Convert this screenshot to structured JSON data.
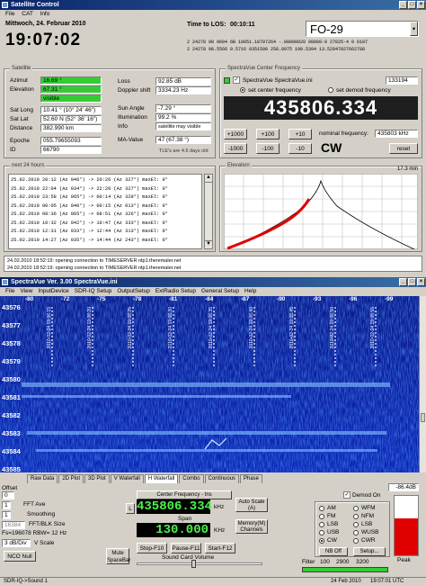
{
  "app1": {
    "title": "Satellite Control",
    "menu": [
      "File",
      "CAT",
      "Info"
    ]
  },
  "clock": {
    "date": "Mittwoch, 24. Februar 2010",
    "time": "19:07:02",
    "los_label": "Time to LOS:",
    "los_value": "00:10:11"
  },
  "sat": {
    "name": "FO-29",
    "tle1": "2 24278 98  9604 6B   10051.18707264  -.00000020  00000-0  27025-4  0  6107",
    "tle2": "2 24278  98.5566  9.5716  0351500  258.8975  190.5394  13.52947827662788"
  },
  "satellite": {
    "label": "Satellite",
    "azimut_label": "Azimut",
    "azimut": "16.69 °",
    "elevation_label": "Elevation",
    "elevation": "67.31 °",
    "status": "visible",
    "satlong_label": "Sat Long",
    "satlong": "10.41 ° (10° 24' 46\")",
    "satlat_label": "Sat Lat",
    "satlat": "52.60 N (52° 36' 16\")",
    "distance_label": "Distance",
    "distance": "382.990 km",
    "epoche_label": "Epoche",
    "epoche": "055.79655093",
    "id_label": "ID",
    "id": "66790",
    "loss_label": "Loss",
    "loss": "92.85 dB",
    "doppler_label": "Doppler shift",
    "doppler": "3334.23 Hz",
    "sun_label": "Sun Angle",
    "sun": "-7.29 °",
    "illum_label": "Illumination",
    "illum": "99.2 %",
    "info_label": "Info",
    "info": "satellite may visible",
    "ma_label": "MA-Value",
    "ma": "47 (67.38 °)",
    "tle_age": "TLE's are 4.6 days old"
  },
  "svc": {
    "label": "SpectraVue Center Frequency",
    "file": "SpectraVue SpectraVue.ini",
    "num": "133194",
    "radio1": "set center frequency",
    "radio2": "set demod frequency",
    "freq": "435806.334",
    "b1": "+1000",
    "b2": "+100",
    "b3": "+10",
    "b4": "-1000",
    "b5": "-100",
    "b6": "-10",
    "nominal_label": "nominal frequency:",
    "nominal": "435803 kHz",
    "mode": "CW",
    "reset": "reset"
  },
  "next": {
    "label": "next 24 hours",
    "rows": [
      "25.02.2010 20:12 (Az 046°) -> 20:26 (Az 327°) maxEl: 0°",
      "25.02.2010 22:04 (Az 034°) -> 22:20 (Az 327°) maxEl: 0°",
      "25.02.2010 23:58 (Az 065°) -> 00:14 (Az 329°) maxEl: 0°",
      "25.02.2010 00:05 (Az 040°) -> 00:15 (Az 013°) maxEl: 0°",
      "25.02.2010 08:36 (Az 065°) -> 08:51 (Az 326°) maxEl: 0°",
      "25.02.2010 10:32 (Az 042°) -> 10:47 (Az 333°) maxEl: 0°",
      "25.02.2010 12:31 (Az 033°) -> 12:44 (Az 313°) maxEl: 0°",
      "25.02.2010 14:27 (Az 035°) -> 14:44 (Az 243°) maxEl: 0°"
    ]
  },
  "elev": {
    "label": "Elevation",
    "time": "17.3 min"
  },
  "log": [
    "24.02.2010 18:52:19: opening connection to TIMESERVER ntp1.theremaler.net",
    "24.02.2010 18:52:19: opening connection to TIMESERVER ntp1.theremaler.net"
  ],
  "app2": {
    "title": "SpectraVue Ver. 3.00 SpectraVue.ini",
    "menu": [
      "File",
      "View",
      "InputDevice",
      "SDR-IQ Setup",
      "OutputSetup",
      "ExtRadio Setup",
      "General Setup",
      "Help"
    ]
  },
  "wf": {
    "dbticks": [
      "-80",
      "-72",
      "-75",
      "-78",
      "-81",
      "-84",
      "-87",
      "-90",
      "-93",
      "-96",
      "-99"
    ],
    "freqticks": [
      "43576",
      "43577",
      "43578",
      "43579",
      "43580",
      "43581",
      "43582",
      "43583",
      "43584",
      "43585"
    ],
    "stamps": [
      "2010-02-24 19:06:15",
      "2010-02-24 19:06:20",
      "2010-02-24 19:06:25",
      "2010-02-24 19:06:30",
      "2010-02-24 19:06:35",
      "2010-02-24 19:06:40",
      "2010-02-24 19:06:45",
      "2010-02-24 19:06:50",
      "2010-02-24 19:06:55"
    ]
  },
  "tabs": [
    "Raw Data",
    "2D Plot",
    "3D Plot",
    "V Waterfall",
    "H Waterfall",
    "Combo",
    "Continuous",
    "Phase"
  ],
  "ctl": {
    "offset": "Offset",
    "offset_val": "0",
    "fftave": "FFT Ave",
    "fftave_val": "1",
    "smooth": "Smoothing",
    "smooth_val": "1",
    "fftsize": "16384",
    "fftblk": "FFT/BLK Size",
    "fs": "Fs=196078 RBW= 12 Hz",
    "vscale_val": "3 dB/Div",
    "vscale": "V Scale",
    "ncd": "NCO Null",
    "l_btn": "L",
    "cf_label": "Center Frequency - Ins",
    "cf": "435806.334",
    "cf_unit": "kHz",
    "span_label": "Span",
    "span": "130.000",
    "span_unit": "KHz",
    "auto_scale": "Auto Scale (A)",
    "mem": "Memory(M) Channels",
    "mute": "Mute SpaceBar",
    "stop": "Stop-F10",
    "pause": "Pause-F11",
    "start": "Start-F12",
    "scv": "Sound Card Volume",
    "filter_label": "Filter",
    "filter": [
      "100",
      "2900",
      "3200"
    ],
    "demod_on": "Demod On",
    "modes": [
      "AM",
      "FM",
      "LSB",
      "USB",
      "CW"
    ],
    "modes2": [
      "WFM",
      "NFM",
      "LSB",
      "WUSB",
      "CWR"
    ],
    "nboff": "NB Off",
    "setup": "Setup...",
    "peak": "Peak",
    "db": "-86.4dB"
  },
  "status": {
    "left": "SDR-IQ->Sound 1",
    "date": "24 Feb 2010",
    "time": "19:07:01 UTC"
  }
}
